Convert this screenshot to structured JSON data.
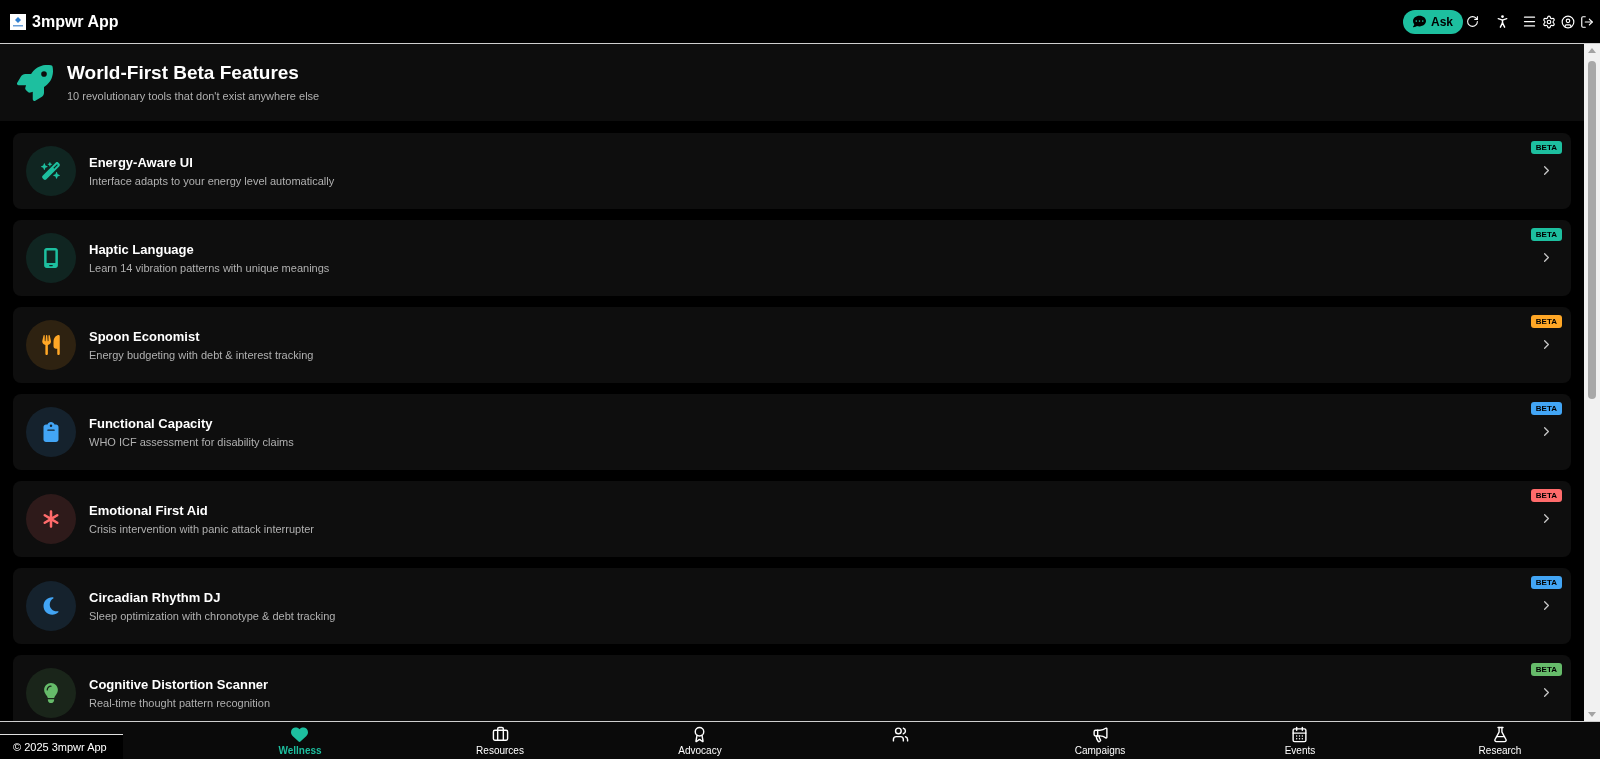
{
  "app_bar": {
    "title": "3mpwr App",
    "ask_button": "Ask"
  },
  "section": {
    "title": "World-First Beta Features",
    "subtitle": "10 revolutionary tools that don't exist anywhere else"
  },
  "features": [
    {
      "title": "Energy-Aware UI",
      "description": "Interface adapts to your energy level automatically",
      "badge": "BETA",
      "color": "#1dbf9f"
    },
    {
      "title": "Haptic Language",
      "description": "Learn 14 vibration patterns with unique meanings",
      "badge": "BETA",
      "color": "#1dbf9f"
    },
    {
      "title": "Spoon Economist",
      "description": "Energy budgeting with debt & interest tracking",
      "badge": "BETA",
      "color": "#ffa726"
    },
    {
      "title": "Functional Capacity",
      "description": "WHO ICF assessment for disability claims",
      "badge": "BETA",
      "color": "#42a5f5"
    },
    {
      "title": "Emotional First Aid",
      "description": "Crisis intervention with panic attack interrupter",
      "badge": "BETA",
      "color": "#ff6b6b"
    },
    {
      "title": "Circadian Rhythm DJ",
      "description": "Sleep optimization with chronotype & debt tracking",
      "badge": "BETA",
      "color": "#42a5f5"
    },
    {
      "title": "Cognitive Distortion Scanner",
      "description": "Real-time thought pattern recognition",
      "badge": "BETA",
      "color": "#66bb6a"
    }
  ],
  "footer": {
    "copyright": "© 2025 3mpwr App"
  },
  "bottom_nav": [
    {
      "label": "Wellness",
      "selected": true
    },
    {
      "label": "Resources",
      "selected": false
    },
    {
      "label": "Advocacy",
      "selected": false
    },
    {
      "selected": false
    },
    {
      "label": "Campaigns",
      "selected": false
    },
    {
      "label": "Events",
      "selected": false
    },
    {
      "label": "Research",
      "selected": false
    }
  ]
}
